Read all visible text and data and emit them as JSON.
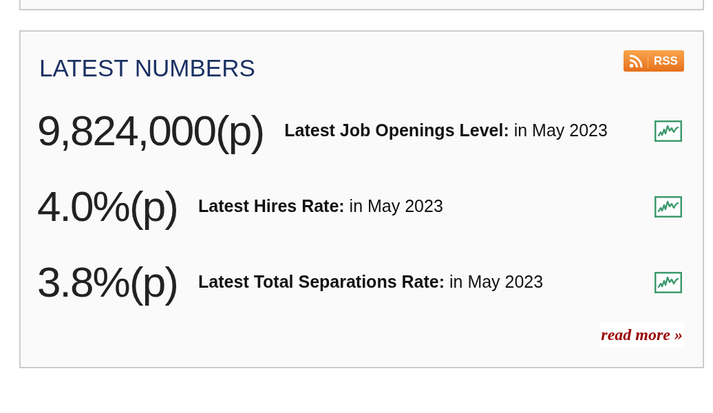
{
  "panel": {
    "title": "LATEST NUMBERS",
    "rss": {
      "label": "RSS"
    }
  },
  "items": [
    {
      "value": "9,824,000(p)",
      "label": "**Latest Job Openings Level:** in May 2023"
    },
    {
      "value": "4.0%(p)",
      "label": "**Latest Hires Rate:** in May 2023"
    },
    {
      "value": "3.8%(p)",
      "label": "**Latest Total Separations Rate:** in May 2023"
    }
  ],
  "read_more": "read more »"
}
